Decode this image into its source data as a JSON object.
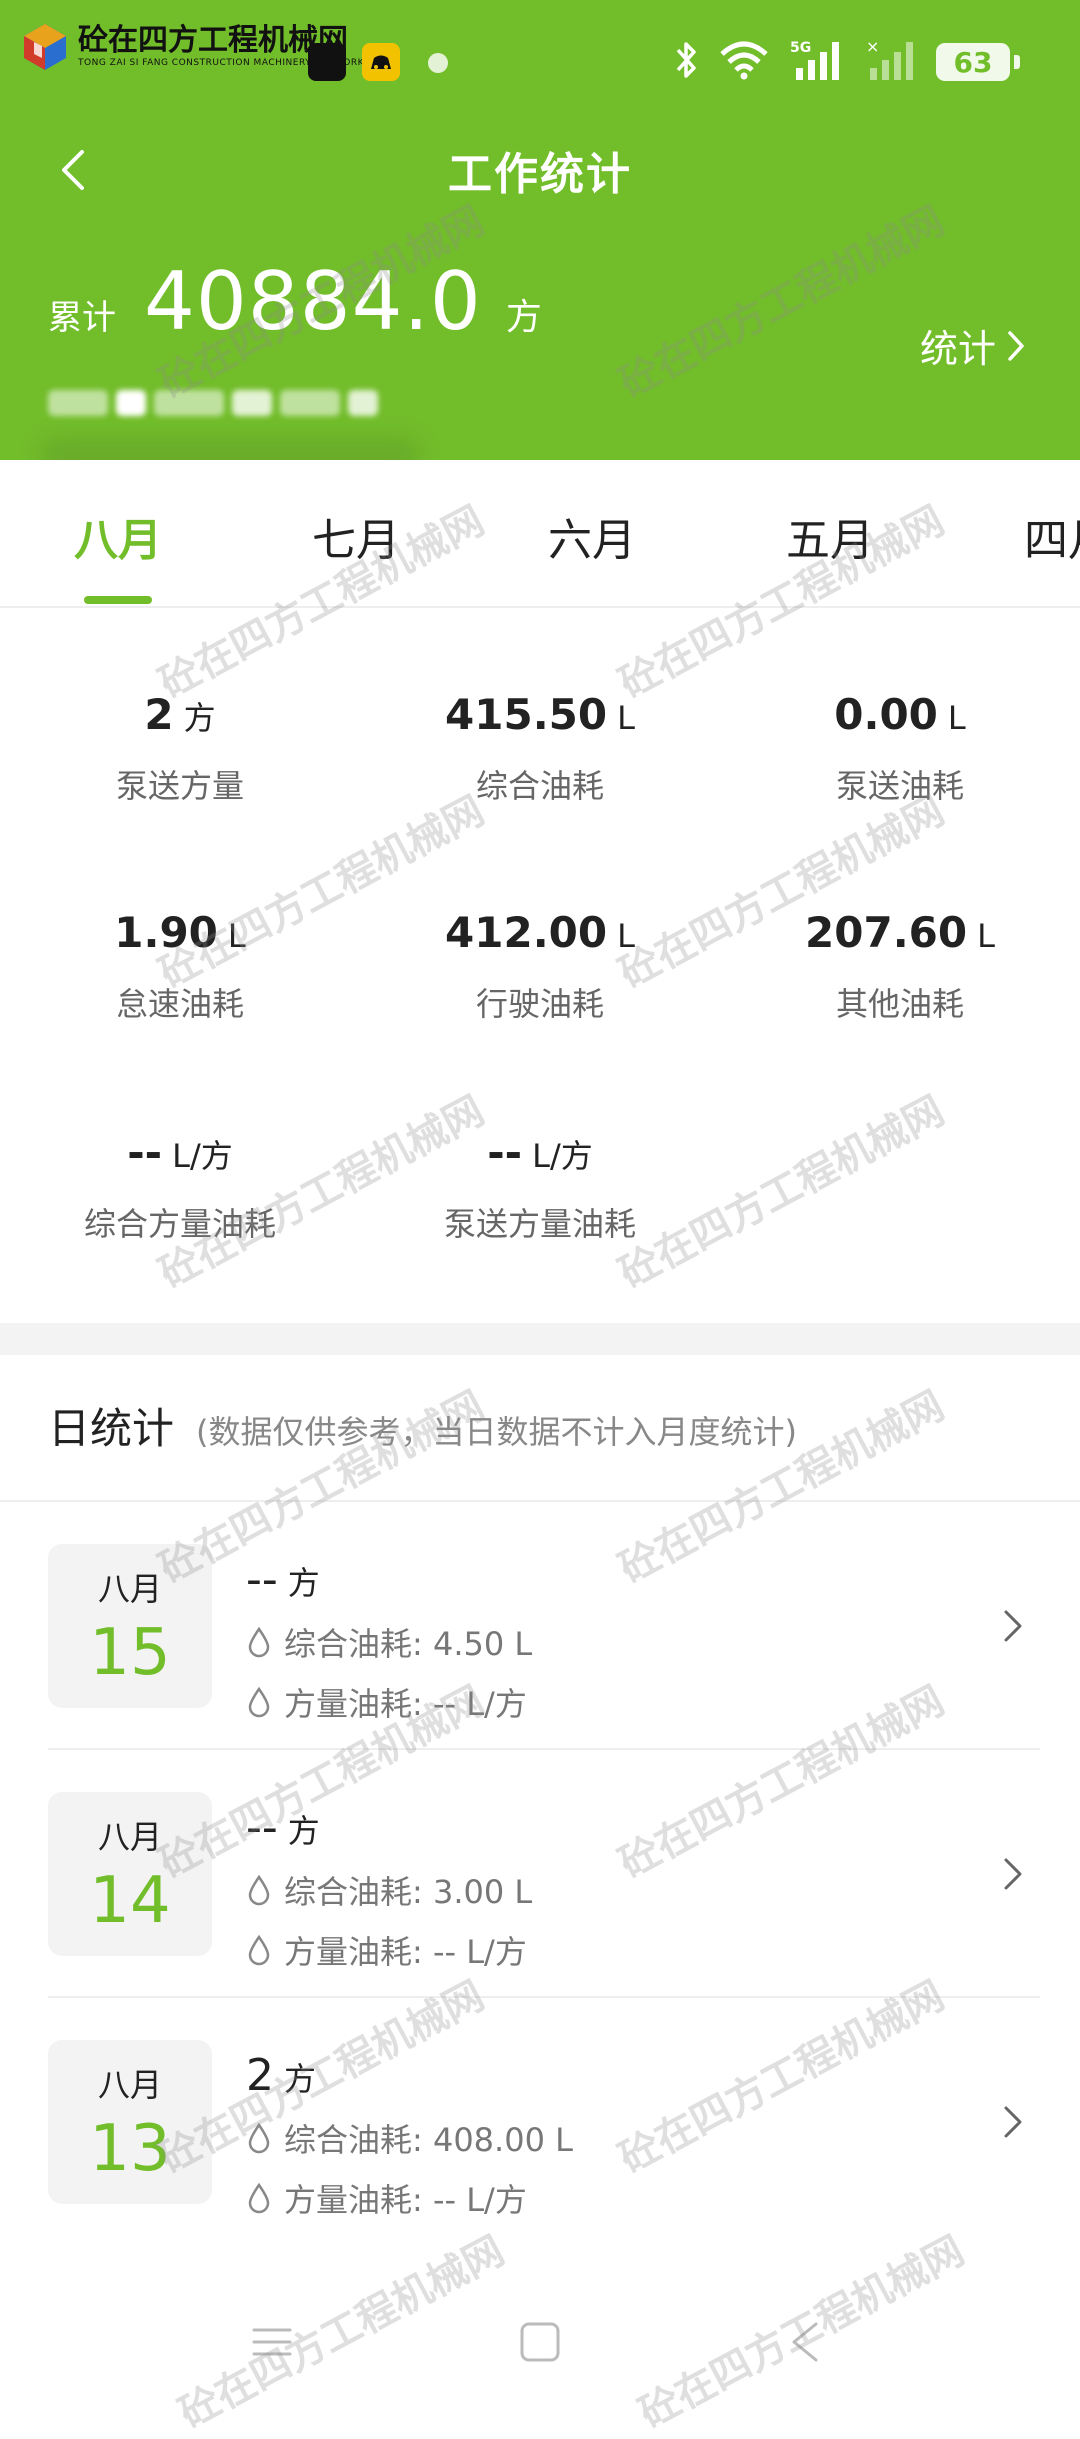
{
  "logo": {
    "title": "砼在四方工程机械网",
    "subtitle": "TONG ZAI SI FANG CONSTRUCTION MACHINERY NETWORK"
  },
  "statusbar": {
    "battery": "63",
    "network": "5G"
  },
  "header": {
    "title": "工作统计",
    "total_label": "累计",
    "total_value": "40884.0",
    "total_unit": "方",
    "stats_link": "统计"
  },
  "tabs": [
    "八月",
    "七月",
    "六月",
    "五月",
    "四月"
  ],
  "metrics": [
    {
      "value": "2",
      "unit": "方",
      "label": "泵送方量"
    },
    {
      "value": "415.50",
      "unit": "L",
      "label": "综合油耗"
    },
    {
      "value": "0.00",
      "unit": "L",
      "label": "泵送油耗"
    },
    {
      "value": "1.90",
      "unit": "L",
      "label": "怠速油耗"
    },
    {
      "value": "412.00",
      "unit": "L",
      "label": "行驶油耗"
    },
    {
      "value": "207.60",
      "unit": "L",
      "label": "其他油耗"
    },
    {
      "value": "--",
      "unit": "L/方",
      "label": "综合方量油耗"
    },
    {
      "value": "--",
      "unit": "L/方",
      "label": "泵送方量油耗"
    }
  ],
  "daily": {
    "title": "日统计",
    "note": "(数据仅供参考，当日数据不计入月度统计)",
    "rows": [
      {
        "month": "八月",
        "day": "15",
        "amount": "--",
        "amount_unit": "方",
        "fuel": "综合油耗: 4.50 L",
        "per_unit": "方量油耗: -- L/方"
      },
      {
        "month": "八月",
        "day": "14",
        "amount": "--",
        "amount_unit": "方",
        "fuel": "综合油耗: 3.00 L",
        "per_unit": "方量油耗: -- L/方"
      },
      {
        "month": "八月",
        "day": "13",
        "amount": "2",
        "amount_unit": "方",
        "fuel": "综合油耗: 408.00 L",
        "per_unit": "方量油耗: -- L/方"
      }
    ]
  },
  "colors": {
    "accent": "#72bd2a",
    "background": "#ffffff"
  },
  "watermark": "砼在四方工程机械网"
}
